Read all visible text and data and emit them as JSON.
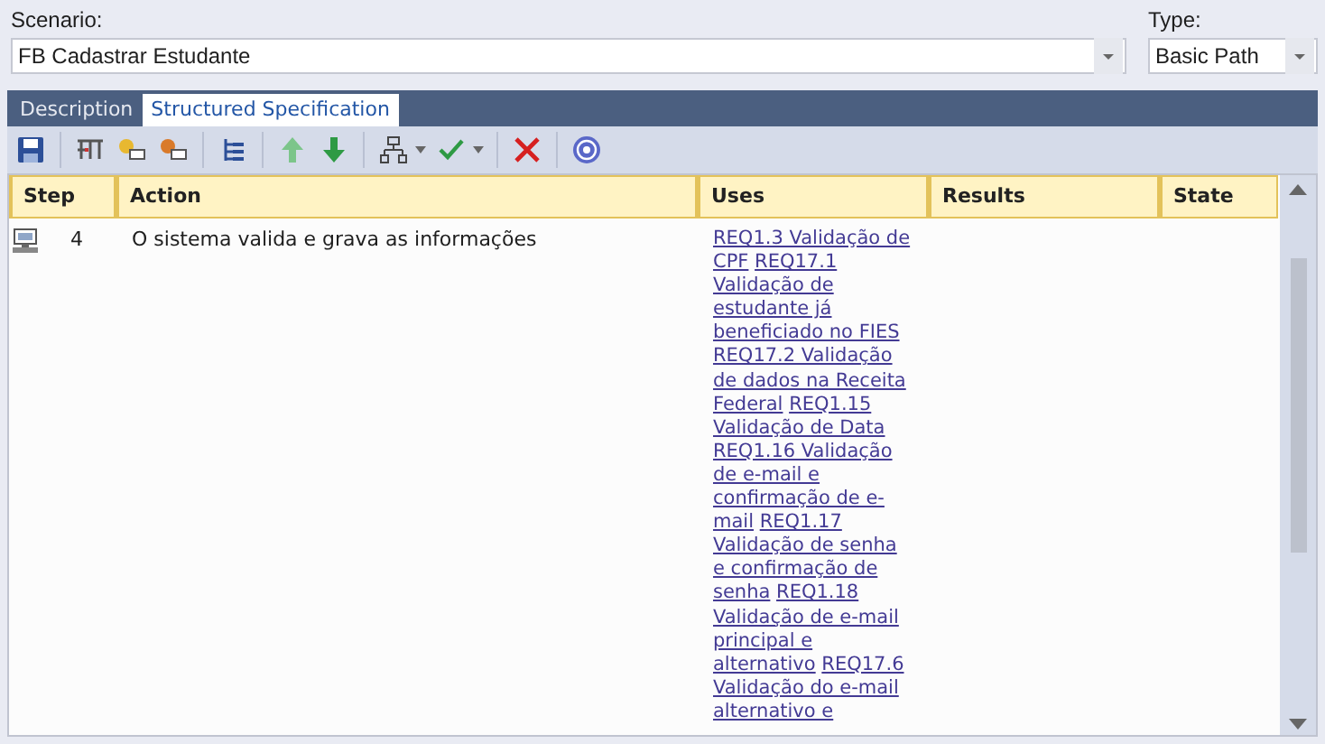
{
  "scenario": {
    "label": "Scenario:",
    "value": "FB Cadastrar Estudante"
  },
  "type": {
    "label": "Type:",
    "value": "Basic Path"
  },
  "tabs": [
    {
      "label": "Description",
      "selected": false
    },
    {
      "label": "Structured Specification",
      "selected": true
    }
  ],
  "toolbar": [
    {
      "kind": "save"
    },
    {
      "kind": "sep"
    },
    {
      "kind": "split"
    },
    {
      "kind": "add-left"
    },
    {
      "kind": "add-right"
    },
    {
      "kind": "sep"
    },
    {
      "kind": "tree"
    },
    {
      "kind": "sep"
    },
    {
      "kind": "up"
    },
    {
      "kind": "down"
    },
    {
      "kind": "sep"
    },
    {
      "kind": "org",
      "dropdown": true
    },
    {
      "kind": "check",
      "dropdown": true
    },
    {
      "kind": "sep"
    },
    {
      "kind": "delete"
    },
    {
      "kind": "sep"
    },
    {
      "kind": "help"
    }
  ],
  "table": {
    "columns": [
      "Step",
      "Action",
      "Uses",
      "Results",
      "State"
    ],
    "rows": [
      {
        "step": "4",
        "action": "O sistema valida e grava as informações",
        "uses": [
          "REQ1.3 Validação de CPF",
          "REQ17.1 Validação de estudante já beneficiado no FIES",
          "REQ17.2 Validação de dados na Receita Federal",
          "REQ1.15 Validação de Data",
          "REQ1.16 Validação de e-mail e confirmação de e-mail",
          "REQ1.17 Validação de senha e confirmação de senha",
          "REQ1.18 Validação de e-mail principal e alternativo",
          "REQ17.6 Validação do e-mail alternativo e"
        ]
      }
    ]
  }
}
